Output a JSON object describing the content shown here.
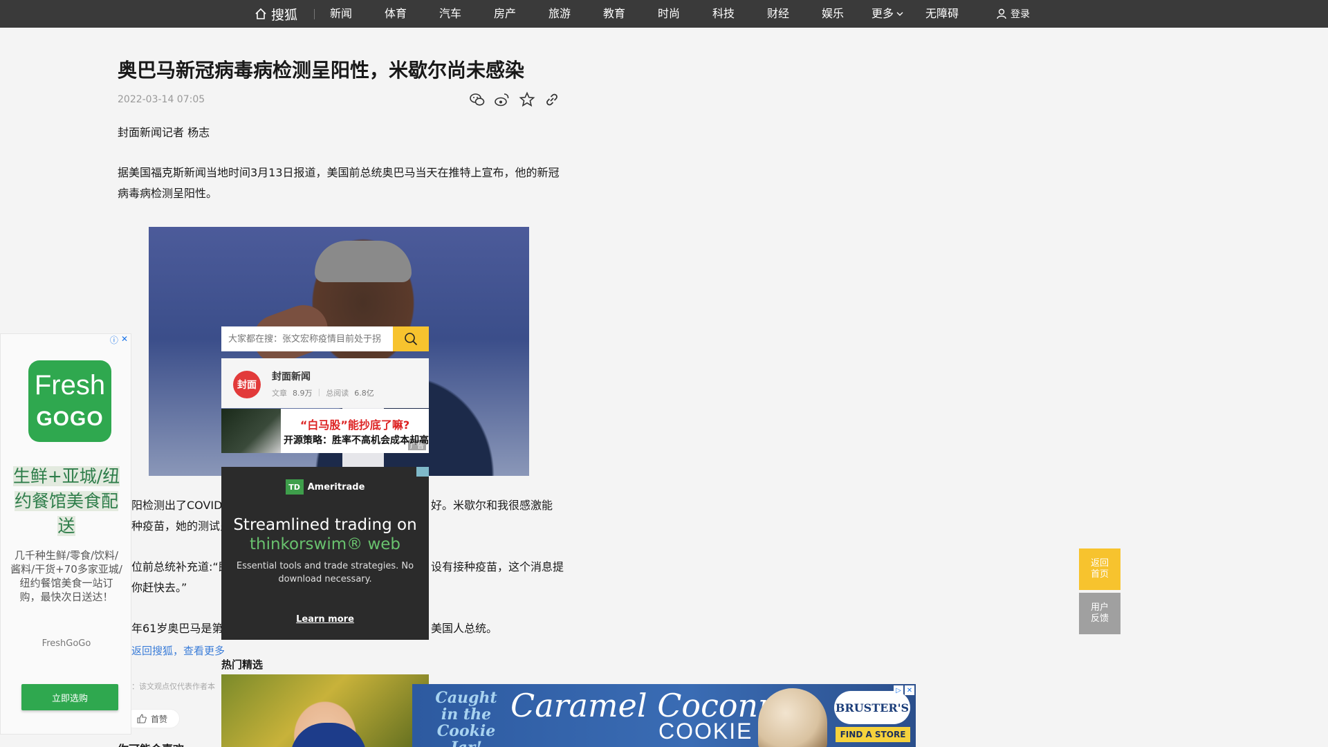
{
  "nav": {
    "home_label": "搜狐",
    "items": [
      "新闻",
      "体育",
      "汽车",
      "房产",
      "旅游",
      "教育",
      "时尚",
      "科技",
      "财经",
      "娱乐"
    ],
    "more_label": "更多",
    "accessibility_label": "无障碍",
    "login_label": "登录"
  },
  "article": {
    "title": "奥巴马新冠病毒病检测呈阳性，米歇尔尚未感染",
    "date": "2022-03-14 07:05",
    "byline": "封面新闻记者 杨志",
    "para1": "据美国福克斯新闻当地时间3月13日报道，美国前总统奥巴马当天在推特上宣布，他的新冠病毒病检测呈阳性。",
    "para2_left": "阳检测出了COVID",
    "para2_right": "好。米歇尔和我很感激能",
    "para2b_left": "种疫苗，她的测试呈",
    "para3_left": "位前总统补充道:“即",
    "para3_right": "设有接种疫苗，这个消息提",
    "para3b_left": "你赶快去。”",
    "para4_left": "年61岁奥巴马是第4",
    "para4_right": "美国人总统。",
    "back_link": "返回搜狐，查看更多",
    "disclaimer": "：该文观点仅代表作者本",
    "like_label": "首赞",
    "cut_text": "你可能会喜欢"
  },
  "overlay": {
    "search_placeholder": "大家都在搜：张文宏称疫情目前处于拐",
    "author_logo": "封面",
    "author_name": "封面新闻",
    "articles_label": "文章",
    "articles_value": "8.9万",
    "reads_label": "总阅读",
    "reads_value": "6.8亿",
    "banner_line1": "“白马股”能抄底了嘛?",
    "banner_line2": "开源策略：胜率不高机会成本却高",
    "banner_ad_tag": "广告"
  },
  "ad_td": {
    "logo_box": "TD",
    "logo_text": "Ameritrade",
    "headline1": "Streamlined trading on",
    "headline2": "thinkorswim® web",
    "sub": "Essential tools and trade strategies. No download necessary.",
    "cta": "Learn more"
  },
  "hot": {
    "title": "热门精选"
  },
  "ad_left": {
    "logo_line1": "Fresh",
    "logo_line2": "GOGO",
    "headline": "生鲜+亚城/纽约餐馆美食配送",
    "body": "几千种生鲜/零食/饮料/酱料/干货+70多家亚城/纽约餐馆美食一站订购，最快次日送达！",
    "brand": "FreshGoGo",
    "cta": "立即选购"
  },
  "float": {
    "home": "返回\n首页",
    "feedback": "用户\n反馈"
  },
  "ad_bottom": {
    "caught": "Caught in the Cookie Jar!",
    "product": "Caramel Coconut",
    "product2": "COOKIE",
    "brand": "BRUSTER'S",
    "store_cta": "FIND A STORE"
  },
  "colors": {
    "nav_bg": "#3a3a3a",
    "accent_yellow": "#f7c32e",
    "link_blue": "#3b7dd8",
    "fresh_green": "#2fa84f"
  }
}
